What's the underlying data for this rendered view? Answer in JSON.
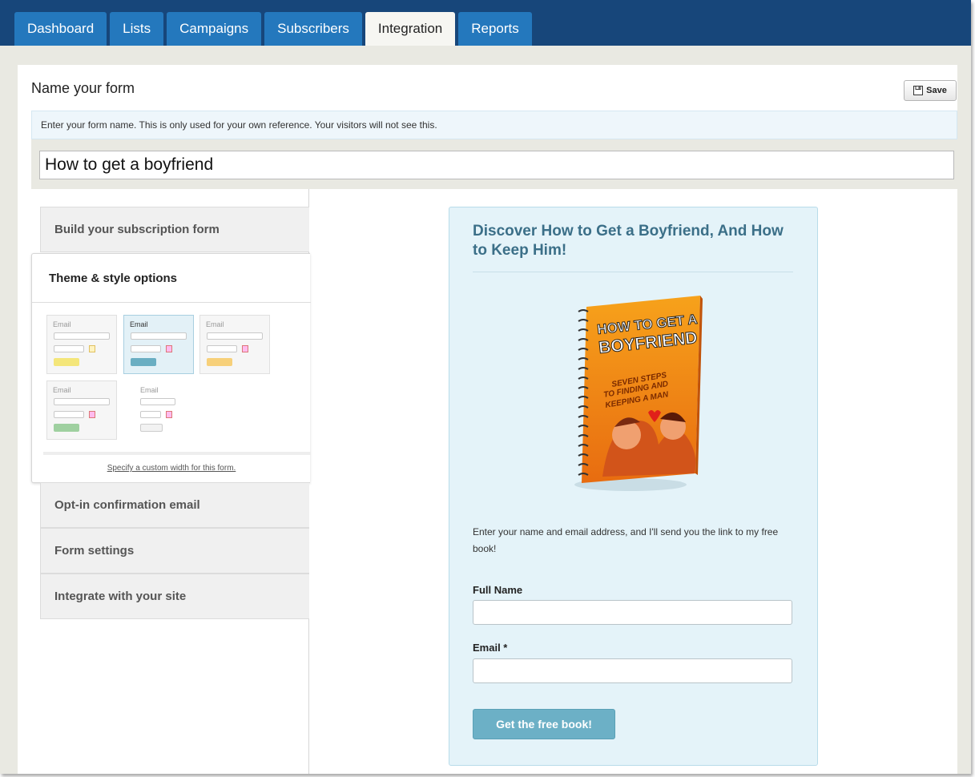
{
  "nav": {
    "tabs": [
      {
        "label": "Dashboard"
      },
      {
        "label": "Lists"
      },
      {
        "label": "Campaigns"
      },
      {
        "label": "Subscribers"
      },
      {
        "label": "Integration",
        "active": true
      },
      {
        "label": "Reports"
      }
    ]
  },
  "header": {
    "title": "Name your form",
    "save_label": "Save",
    "info": "Enter your form name. This is only used for your own reference. Your visitors will not see this.",
    "form_name_value": "How to get a boyfriend"
  },
  "sidebar": {
    "sections": [
      {
        "label": "Build your subscription form"
      },
      {
        "label": "Theme & style options",
        "open": true
      },
      {
        "label": "Opt-in confirmation email"
      },
      {
        "label": "Form settings"
      },
      {
        "label": "Integrate with your site"
      }
    ],
    "theme_option_label": "Email",
    "custom_width_link": "Specify a custom width for this form.",
    "theme_colors": [
      "#f4e67a",
      "#6aaec2",
      "#f7d07a",
      "#9fd0a0",
      "#f2f2f2"
    ]
  },
  "preview": {
    "title": "Discover How to Get a Boyfriend, And How to Keep Him!",
    "book": {
      "title_line1": "HOW TO GET A",
      "title_line2": "BOYFRIEND",
      "subtitle_line1": "SEVEN STEPS",
      "subtitle_line2": "TO FINDING AND",
      "subtitle_line3": "KEEPING A MAN"
    },
    "description": "Enter your name and email address, and I'll send you the link to my free book!",
    "full_name_label": "Full Name",
    "email_label": "Email *",
    "submit_label": "Get the free book!"
  },
  "colors": {
    "nav_bg": "#17467a",
    "tab_bg": "#2478bd",
    "preview_title": "#3b6f88",
    "submit_bg": "#6cb0c6"
  }
}
